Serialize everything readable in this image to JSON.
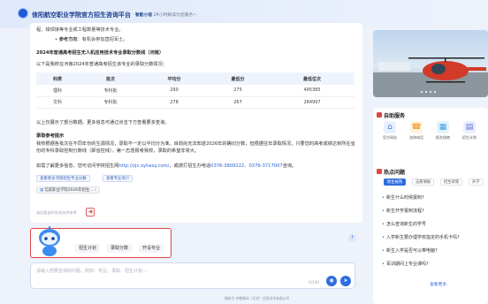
{
  "header": {
    "title": "信阳航空职业学院官方招生咨询平台",
    "badge": "智能小信",
    "slogan": "·24小时解读为您服务~"
  },
  "content": {
    "line1": "程、钳焊接等专业或工程数量等技术专业。",
    "bullet_label": "参考方向",
    "bullet_text": "：有机会参加直招军士。",
    "heading": "2024年普通高考招生无人机应用技术专业录取分数线（河南）",
    "intro": "以下是我校在河南2024年普通高考招生该专业的录取分数情况：",
    "table": {
      "headers": [
        "科类",
        "批次",
        "平均分",
        "最低分",
        "最低位次"
      ],
      "rows": [
        [
          "理科",
          "专科批",
          "290",
          "275",
          "495385"
        ],
        [
          "文科",
          "专科批",
          "278",
          "267",
          "284997"
        ]
      ]
    },
    "note": "以上仅展示了部分数据。更多信息可通过点击下方查看要多查询。",
    "heading2": "录取参考提示",
    "para1": "我校根据各批次在不同年份的生源情况，录取不一定以平均分为准。目前尚无法知道2026年的确切分数，但根据往年录取情况，只要您的高考成绩达到所在省份的专科录取控制分数线（即省控线），第一志愿报考我校，录取的希望非常大。",
    "para2_prefix": "如需了解更多信息，您可访问学校招生网",
    "para2_link": "http://zjc.xyhaxy.com/",
    "para2_mid": "，或拨打招生办电话",
    "para2_phone": "0376-3809222、0376-3717007",
    "para2_suffix": "咨询。",
    "tags": [
      "查看更多河南招生专业分数",
      "查看专业简介"
    ],
    "file_label": "信航职业学院2026年招生..."
  },
  "toolbar": {
    "hint": "该回复由AI生成仅供参考"
  },
  "robot": {
    "chips": [
      "招生计划",
      "录取分数",
      "开设专业"
    ]
  },
  "input": {
    "placeholder": "请输入想要咨询的问题，例如：专业、录取、招生计划...",
    "counter": "0/100"
  },
  "footer": "随机号 中教数码（北京）信息技术有限公司",
  "sidebar": {
    "services_title": "自助服务",
    "services": [
      {
        "label": "官方网站",
        "color": "#3b7be0"
      },
      {
        "label": "咨询电话",
        "color": "#f0a030"
      },
      {
        "label": "报名指南",
        "color": "#3aa0e8"
      },
      {
        "label": "招生计划",
        "color": "#5b6fe0"
      }
    ],
    "hot_title": "热点问题",
    "hot_tabs": [
      "新生报到",
      "志愿填报",
      "招生政策",
      "升学"
    ],
    "hot_questions": [
      "新生什么时候报到?",
      "新生开学报到流程?",
      "怎么查询新生的学号",
      "入学新生要办理学校指定的手机卡吗?",
      "新生入学是否可以带电脑?",
      "军训期间上专业课吗?"
    ],
    "more": "查看更多"
  },
  "colors": {
    "accent": "#2f6ce0",
    "highlight": "#e04545"
  }
}
